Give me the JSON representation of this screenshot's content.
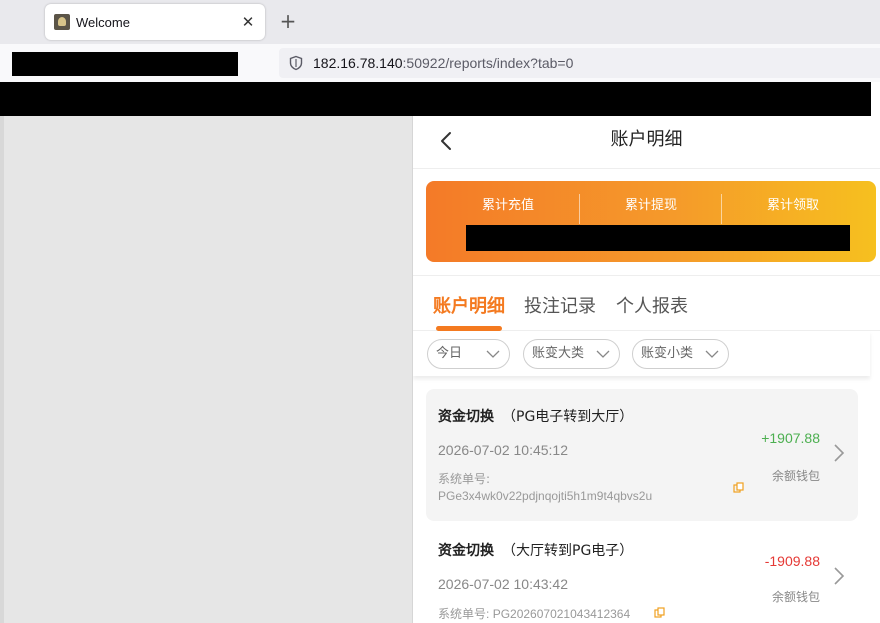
{
  "browser": {
    "tab_title": "Welcome",
    "tab_close": "✕",
    "new_tab": "+",
    "url_host": "182.16.78.140",
    "url_rest": ":50922/reports/index?tab=0"
  },
  "app": {
    "title": "账户明细",
    "stats": {
      "labels": [
        "累计充值",
        "累计提现",
        "累计领取"
      ]
    },
    "tabs": [
      {
        "label": "账户明细",
        "active": true
      },
      {
        "label": "投注记录",
        "active": false
      },
      {
        "label": "个人报表",
        "active": false
      }
    ],
    "filters": [
      {
        "label": "今日"
      },
      {
        "label": "账变大类"
      },
      {
        "label": "账变小类"
      }
    ],
    "records": [
      {
        "title": "资金切换",
        "detail": "（PG电子转到大厅）",
        "time": "2026-07-02 10:45:12",
        "order_label": "系统单号:",
        "order_no": "PGe3x4wk0v22pdjnqojti5h1m9t4qbvs2u",
        "amount": "+1907.88",
        "wallet": "余额钱包"
      },
      {
        "title": "资金切换",
        "detail": "（大厅转到PG电子）",
        "time": "2026-07-02 10:43:42",
        "order_label": "系统单号:",
        "order_no": "PG202607021043412364",
        "amount": "-1909.88",
        "wallet": "余额钱包"
      }
    ]
  },
  "colors": {
    "accent": "#f47a20",
    "positive": "#4caf50",
    "negative": "#e53935"
  }
}
